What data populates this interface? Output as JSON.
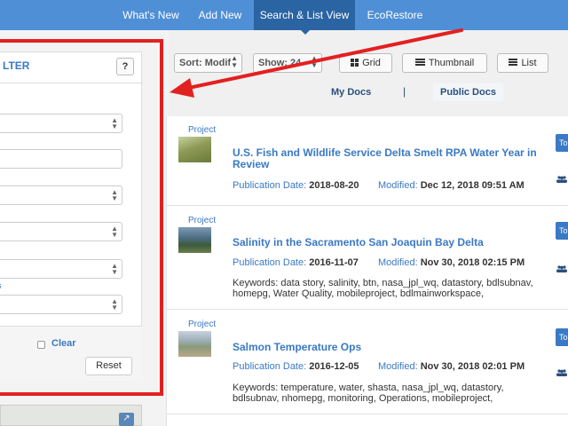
{
  "nav": {
    "items": [
      {
        "label": "What's New"
      },
      {
        "label": "Add New"
      },
      {
        "label": "Search & List View"
      },
      {
        "label": "EcoRestore"
      }
    ],
    "active_index": 2
  },
  "filter": {
    "title": "LTER",
    "help_label": "?",
    "link_text": "gs",
    "clear_label": "Clear",
    "reset_label": "Reset"
  },
  "toolbar": {
    "sort_label": "Sort: Modif",
    "show_label": "Show: 24",
    "grid_label": "Grid",
    "thumbnail_label": "Thumbnail",
    "list_label": "List"
  },
  "doc_tabs": {
    "my_docs": "My Docs",
    "divider": "|",
    "public_docs": "Public Docs"
  },
  "results": [
    {
      "type": "Project",
      "title": "U.S. Fish and Wildlife Service Delta Smelt RPA Water Year in Review",
      "pub_label": "Publication Date:",
      "pub_date": "2018-08-20",
      "mod_label": "Modified:",
      "modified": "Dec 12, 2018 09:51 AM",
      "keywords": "",
      "side_label": "To"
    },
    {
      "type": "Project",
      "title": "Salinity in the Sacramento San Joaquin Bay Delta",
      "pub_label": "Publication Date:",
      "pub_date": "2016-11-07",
      "mod_label": "Modified:",
      "modified": "Nov 30, 2018 02:15 PM",
      "keywords": "Keywords: data story, salinity, btn, nasa_jpl_wq, datastory, bdlsubnav, homepg, Water Quality, mobileproject, bdlmainworkspace,",
      "side_label": "To"
    },
    {
      "type": "Project",
      "title": "Salmon Temperature Ops",
      "pub_label": "Publication Date:",
      "pub_date": "2016-12-05",
      "mod_label": "Modified:",
      "modified": "Nov 30, 2018 02:01 PM",
      "keywords": "Keywords: temperature, water, shasta, nasa_jpl_wq, datastory, bdlsubnav, nhomepg, monitoring, Operations, mobileproject,",
      "side_label": "To"
    }
  ],
  "icons": {
    "grid": "grid-icon",
    "thumbnail": "thumbnail-icon",
    "list": "list-icon",
    "people": "people-icon",
    "expand": "expand-icon"
  },
  "colors": {
    "nav_bg": "#4f8fd6",
    "nav_active": "#2b64a3",
    "link_blue": "#3a79c4",
    "annotation_red": "#e32020"
  }
}
